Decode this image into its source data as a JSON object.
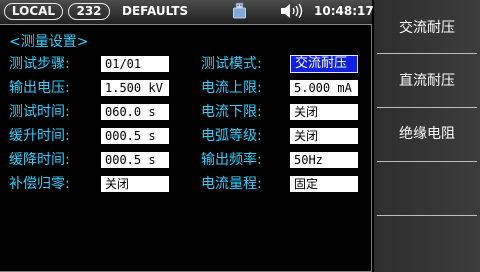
{
  "status": {
    "local_label": "LOCAL",
    "port_label": "232",
    "mode_label": "DEFAULTS",
    "usb_icon": "usb-drive-icon",
    "speaker_icon": "speaker-volume-icon",
    "time": "10:48:17"
  },
  "section_title": "<测量设置>",
  "left_params": [
    {
      "label": "测试步骤:",
      "value": "01/01"
    },
    {
      "label": "输出电压:",
      "value": "1.500 kV"
    },
    {
      "label": "测试时间:",
      "value": "060.0 s"
    },
    {
      "label": "缓升时间:",
      "value": "000.5 s"
    },
    {
      "label": "缓降时间:",
      "value": "000.5 s"
    },
    {
      "label": "补偿归零:",
      "value": "关闭"
    }
  ],
  "right_params": [
    {
      "label": "测试模式:",
      "value": "交流耐压"
    },
    {
      "label": "电流上限:",
      "value": "5.000 mA"
    },
    {
      "label": "电流下限:",
      "value": "关闭"
    },
    {
      "label": "电弧等级:",
      "value": "关闭"
    },
    {
      "label": "输出频率:",
      "value": "50Hz"
    },
    {
      "label": "电流量程:",
      "value": "固定"
    }
  ],
  "softkeys": [
    "交流耐压",
    "直流耐压",
    "绝缘电阻",
    "",
    ""
  ],
  "colors": {
    "label": "#2bd0ff",
    "selected_bg": "#1020e0",
    "background": "#000000"
  }
}
